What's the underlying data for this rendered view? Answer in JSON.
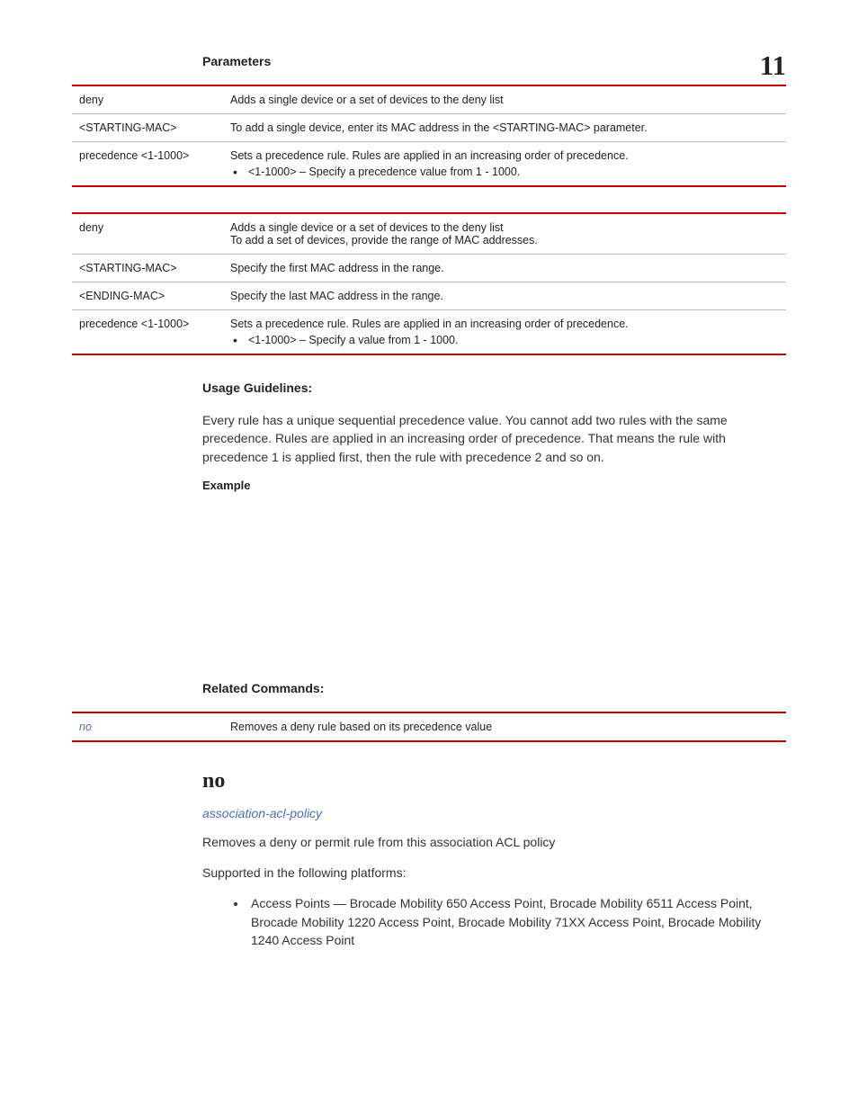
{
  "page_number": "11",
  "sections": {
    "parameters_h": "Parameters",
    "usage_h": "Usage Guidelines:",
    "usage_body": "Every rule has a unique sequential precedence value. You cannot add two rules with the same precedence. Rules are applied in an increasing order of precedence. That means the rule with precedence 1 is applied first, then the rule with precedence 2 and so on.",
    "example_h": "Example",
    "related_h": "Related Commands:"
  },
  "table1": {
    "r1c1": "deny",
    "r1c2": "Adds a single device or a set of devices to the deny list",
    "r2c1": "<STARTING-MAC>",
    "r2c2": "To add a single device, enter its MAC address in the <STARTING-MAC> parameter.",
    "r3c1": "precedence <1-1000>",
    "r3c2a": "Sets a precedence rule. Rules are applied in an increasing order of precedence.",
    "r3c2b": "<1-1000> – Specify a precedence value from 1 - 1000."
  },
  "table2": {
    "r1c1": "deny",
    "r1c2a": "Adds a single device or a set of devices to the deny list",
    "r1c2b": "To add a set of devices, provide the range of MAC addresses.",
    "r2c1": "<STARTING-MAC>",
    "r2c2": "Specify the first MAC address in the range.",
    "r3c1": "<ENDING-MAC>",
    "r3c2": "Specify the last MAC address in the range.",
    "r4c1": "precedence <1-1000>",
    "r4c2a": "Sets a precedence rule. Rules are applied in an increasing order of precedence.",
    "r4c2b": "<1-1000> – Specify a value from 1 - 1000."
  },
  "related_table": {
    "r1c1": "no",
    "r1c2": "Removes a deny rule based on its precedence value"
  },
  "no_section": {
    "title": "no",
    "policy_link": "association-acl-policy",
    "desc": "Removes a deny or permit rule from this association ACL policy",
    "supported": "Supported in the following platforms:",
    "platform_item": "Access Points — Brocade Mobility 650 Access Point, Brocade Mobility 6511 Access Point, Brocade Mobility 1220 Access Point, Brocade Mobility 71XX Access Point, Brocade Mobility 1240 Access Point"
  }
}
